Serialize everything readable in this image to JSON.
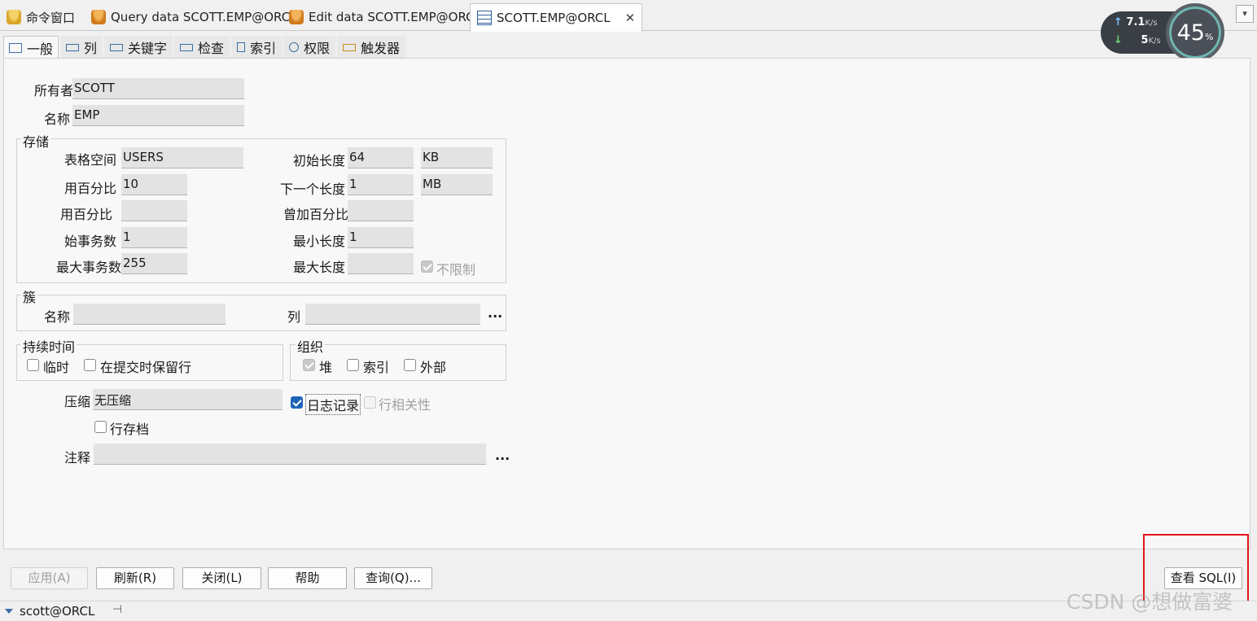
{
  "doc_tabs": [
    {
      "label": "命令窗口",
      "icon": "database-icon"
    },
    {
      "label": "Query data SCOTT.EMP@ORCL",
      "icon": "database-icon"
    },
    {
      "label": "Edit data SCOTT.EMP@ORCL",
      "icon": "database-icon"
    },
    {
      "label": "SCOTT.EMP@ORCL",
      "icon": "table-icon",
      "active": true
    }
  ],
  "close_glyph": "✕",
  "dropdown_glyph": "▾",
  "network": {
    "upload": "7.1",
    "upload_unit": "K/s",
    "download": "5",
    "download_unit": "K/s",
    "percent": "45",
    "percent_unit": "%",
    "up_arrow": "↑",
    "down_arrow": "↓"
  },
  "prop_tabs": [
    "一般",
    "列",
    "关键字",
    "检查",
    "索引",
    "权限",
    "触发器"
  ],
  "general": {
    "owner_label": "所有者",
    "owner_value": "SCOTT",
    "name_label": "名称",
    "name_value": "EMP"
  },
  "storage": {
    "title": "存储",
    "tablespace_label": "表格空间",
    "tablespace_value": "USERS",
    "pct_used_label": "用百分比",
    "pct_used_value": "10",
    "pct_free_label": "用百分比",
    "pct_free_value": "",
    "initrans_label": "始事务数",
    "initrans_value": "1",
    "maxtrans_label": "最大事务数",
    "maxtrans_value": "255",
    "initial_label": "初始长度",
    "initial_value": "64",
    "initial_unit": "KB",
    "next_label": "下一个长度",
    "next_value": "1",
    "next_unit": "MB",
    "pctinc_label": "曾加百分比",
    "pctinc_value": "",
    "minext_label": "最小长度",
    "minext_value": "1",
    "maxext_label": "最大长度",
    "maxext_value": "",
    "unlimited_label": "不限制"
  },
  "cluster": {
    "title": "簇",
    "name_label": "名称",
    "name_value": "",
    "columns_label": "列",
    "columns_value": "",
    "ellipsis": "..."
  },
  "duration": {
    "title": "持续时间",
    "temporary_label": "临时",
    "preserve_label": "在提交时保留行"
  },
  "organization": {
    "title": "组织",
    "heap_label": "堆",
    "index_label": "索引",
    "external_label": "外部"
  },
  "compression": {
    "label": "压缩",
    "value": "无压缩"
  },
  "logging_label": "日志记录",
  "row_dependencies_label": "行相关性",
  "row_archival_label": "行存档",
  "comment": {
    "label": "注释",
    "value": "",
    "ellipsis": "..."
  },
  "buttons": {
    "apply": "应用(A)",
    "refresh": "刷新(R)",
    "close": "关闭(L)",
    "help": "帮助",
    "query": "查询(Q)...",
    "view_sql": "查看 SQL(I)"
  },
  "status": {
    "connection": "scott@ORCL",
    "pin_glyph": "⊣"
  },
  "watermark": "CSDN @想做富婆"
}
